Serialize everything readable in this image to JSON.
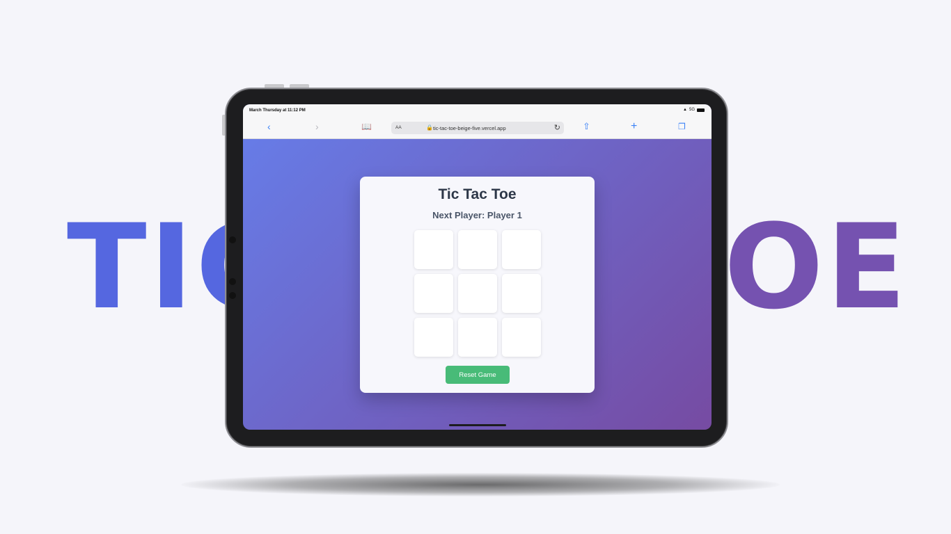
{
  "background": {
    "word_left": "TIC",
    "word_right": "OE",
    "color_left": "#5567e0",
    "color_right": "#7552b0"
  },
  "browser": {
    "status_time": "March Thursday at 11:12 PM",
    "status_signal": "5G",
    "url_aa": "AA",
    "url": "tic-tac-toe-beige-five.vercel.app",
    "icons": {
      "back": "chevron-left-icon",
      "forward": "chevron-right-icon",
      "reader": "book-icon",
      "lock": "lock-icon",
      "reload": "reload-icon",
      "share": "share-icon",
      "new_tab": "plus-icon",
      "tabs": "tabs-icon"
    }
  },
  "game": {
    "title": "Tic Tac Toe",
    "status": "Next Player: Player 1",
    "cells": [
      "",
      "",
      "",
      "",
      "",
      "",
      "",
      "",
      ""
    ],
    "reset_label": "Reset Game",
    "colors": {
      "gradient_start": "#667eea",
      "gradient_end": "#764ba2",
      "reset_button": "#48bb78"
    }
  }
}
